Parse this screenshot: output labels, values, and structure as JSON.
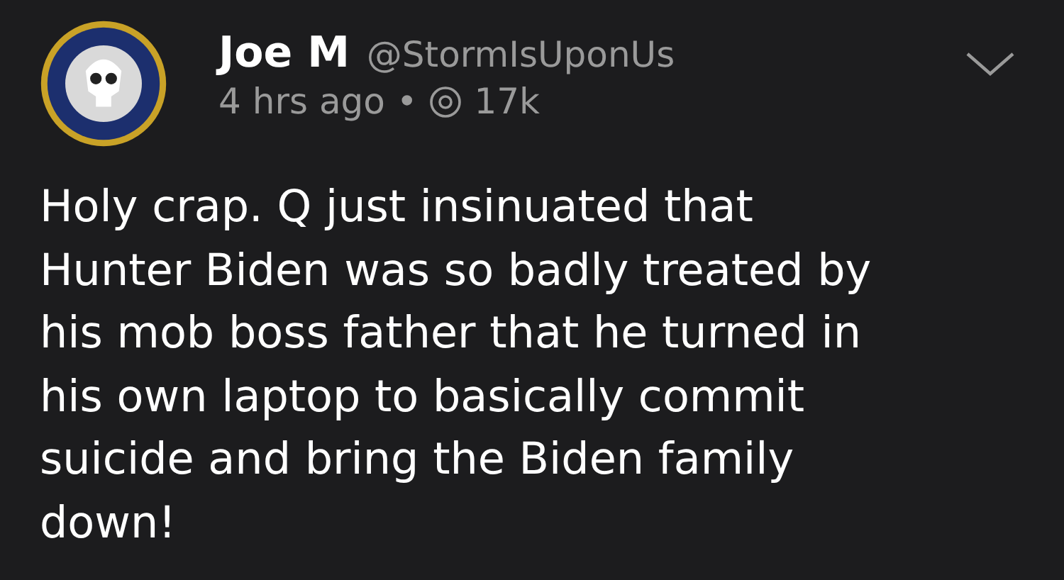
{
  "post": {
    "author_name": "Joe M",
    "handle": "@StormIsUponUs",
    "time": "4 hrs ago",
    "separator": "•",
    "views": "17k",
    "body_lines": [
      "Holy crap. Q just insinuated that",
      "Hunter Biden was so badly treated by",
      "his mob boss father that he turned in",
      "his own laptop to basically commit",
      "suicide and bring the Biden family",
      "down!"
    ]
  }
}
